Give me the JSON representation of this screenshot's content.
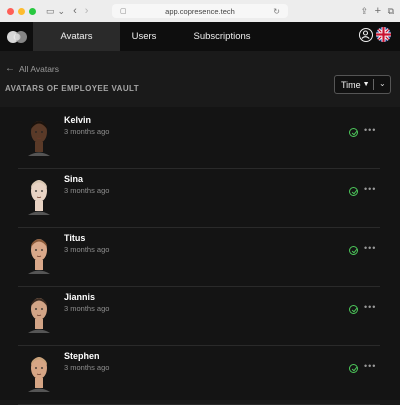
{
  "browser": {
    "url": "app.copresence.tech"
  },
  "header": {
    "tabs": [
      {
        "label": "Avatars",
        "active": true
      },
      {
        "label": "Users",
        "active": false
      },
      {
        "label": "Subscriptions",
        "active": false
      }
    ]
  },
  "back_link": "All Avatars",
  "page_title": "AVATARS OF EMPLOYEE VAULT",
  "sort": {
    "label": "Time"
  },
  "avatars": [
    {
      "name": "Kelvin",
      "time": "3 months ago",
      "skin": "#5a3a28",
      "hair": "#1a120c"
    },
    {
      "name": "Sina",
      "time": "3 months ago",
      "skin": "#e8d3c4",
      "hair": "#d9c7b2"
    },
    {
      "name": "Titus",
      "time": "3 months ago",
      "skin": "#d9a88a",
      "hair": "#8a5a3a"
    },
    {
      "name": "Jiannis",
      "time": "3 months ago",
      "skin": "#d2a486",
      "hair": "#3a2a20"
    },
    {
      "name": "Stephen",
      "time": "3 months ago",
      "skin": "#d6a585",
      "hair": "#c9a27a"
    }
  ],
  "colors": {
    "status_ok": "#4cc65a",
    "background": "#1a1a1a"
  }
}
